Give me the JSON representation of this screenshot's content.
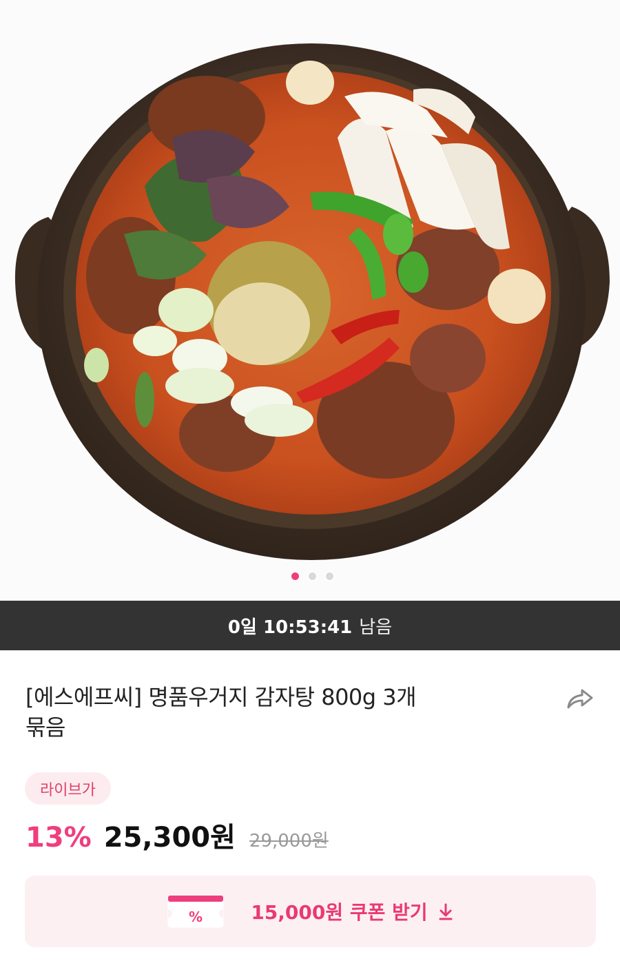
{
  "hero": {
    "image_alt": "감자탕",
    "carousel": {
      "total": 3,
      "active_index": 0
    }
  },
  "timer": {
    "time": "0일 10:53:41",
    "suffix": "남음"
  },
  "product": {
    "title_line1": "[에스에프씨] 명품우거지 감자탕 800g 3개",
    "title_line2": "묶음",
    "badge": "라이브가",
    "discount": "13%",
    "price": "25,300원",
    "original_price": "29,000원"
  },
  "coupon": {
    "icon_symbol": "%",
    "label": "15,000원 쿠폰 받기"
  },
  "colors": {
    "accent": "#ef3e7d",
    "timer_bg": "#333333",
    "coupon_bg": "#fdf0f3",
    "badge_bg": "#fdecef"
  },
  "icons": {
    "share": "share-arrow-icon",
    "download": "arrow-down-icon"
  }
}
